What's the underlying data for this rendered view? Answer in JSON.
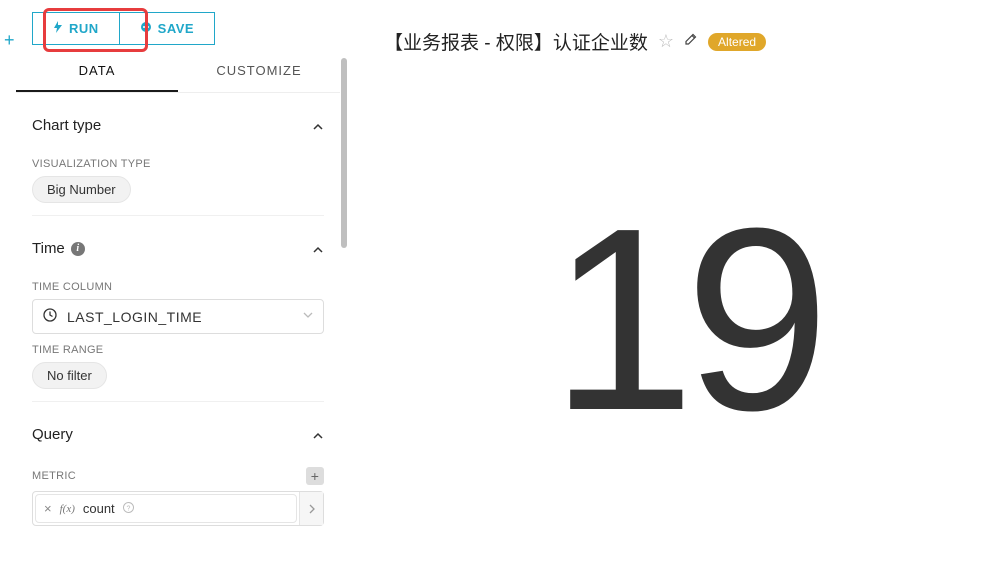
{
  "toolbar": {
    "run_label": "RUN",
    "save_label": "SAVE"
  },
  "tabs": {
    "data": "DATA",
    "customize": "CUSTOMIZE"
  },
  "sections": {
    "chart_type": {
      "title": "Chart type",
      "viz_label": "VISUALIZATION TYPE",
      "viz_value": "Big Number"
    },
    "time": {
      "title": "Time",
      "column_label": "TIME COLUMN",
      "column_value": "LAST_LOGIN_TIME",
      "range_label": "TIME RANGE",
      "range_value": "No filter"
    },
    "query": {
      "title": "Query",
      "metric_label": "METRIC",
      "metric_fx": "f(x)",
      "metric_value": "count"
    }
  },
  "chart": {
    "title": "【业务报表 - 权限】认证企业数",
    "badge": "Altered"
  },
  "chart_data": {
    "type": "big_number",
    "value": 19,
    "metric": "count",
    "title": "【业务报表 - 权限】认证企业数"
  }
}
